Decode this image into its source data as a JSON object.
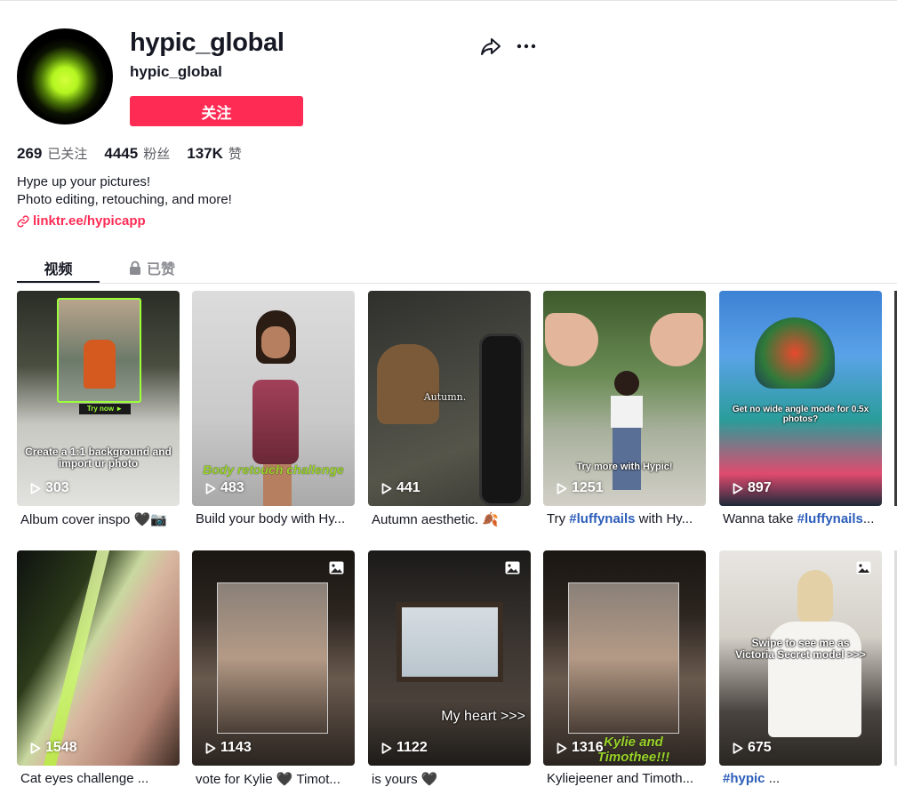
{
  "profile": {
    "title": "hypic_global",
    "subtitle": "hypic_global",
    "follow_label": "关注",
    "stats": [
      {
        "value": "269",
        "label": "已关注"
      },
      {
        "value": "4445",
        "label": "粉丝"
      },
      {
        "value": "137K",
        "label": "赞"
      }
    ],
    "bio": [
      "Hype up your pictures!",
      "Photo editing, retouching, and more!"
    ],
    "link": "linktr.ee/hypicapp"
  },
  "tabs": {
    "videos": "视频",
    "liked": "已赞"
  },
  "videos": [
    {
      "views": "303",
      "caption": "Album cover inspo 🖤📷",
      "overlay": "Create a 1:1 background and import ur photo",
      "badge_text": "Try now ►"
    },
    {
      "views": "483",
      "caption": "Build your body with Hy...",
      "overlay": "Body retouch challenge"
    },
    {
      "views": "441",
      "caption": "Autumn aesthetic. 🍂",
      "overlay": "Autumn."
    },
    {
      "views": "1251",
      "caption_pre": "Try ",
      "caption_tag": "#luffynails",
      "caption_post": " with Hy...",
      "overlay": "Try more with Hypic!"
    },
    {
      "views": "897",
      "caption_pre": "Wanna take ",
      "caption_tag": "#luffynails",
      "caption_post": "...",
      "overlay": "Get no wide angle mode for 0.5x photos?"
    },
    {
      "views": "1548",
      "caption": "Cat eyes challenge ..."
    },
    {
      "views": "1143",
      "caption": "vote for Kylie 🖤 Timot..."
    },
    {
      "views": "1122",
      "caption": "is yours 🖤",
      "overlay": "My heart >>>"
    },
    {
      "views": "1316",
      "caption": "Kyliejeener and Timoth...",
      "overlay": "Kylie and Timothee!!!"
    },
    {
      "views": "675",
      "caption_tag": "#hypic",
      "caption_post": " ...",
      "overlay": "Swipe to see me as Victoria Secret model >>>"
    }
  ],
  "colors": {
    "accent": "#fe2c55",
    "hashtag": "#2b5db9",
    "text": "#161823",
    "muted": "#5c5d63"
  },
  "icons": [
    "share-icon",
    "more-icon",
    "link-icon",
    "lock-icon",
    "play-icon",
    "photo-icon"
  ]
}
